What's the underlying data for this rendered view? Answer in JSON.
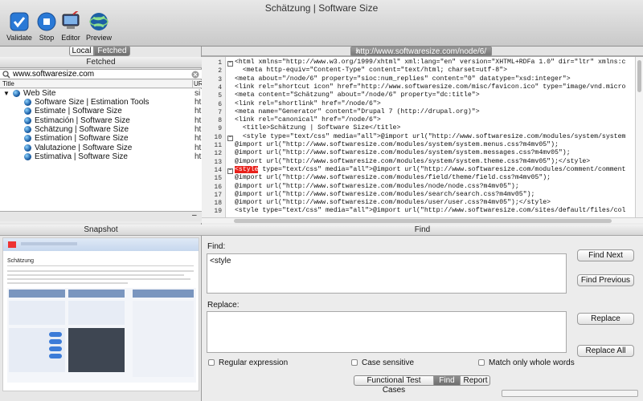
{
  "window": {
    "title": "Schätzung | Software Size"
  },
  "toolbar": [
    {
      "label": "Validate",
      "icon": "validate-icon"
    },
    {
      "label": "Stop",
      "icon": "stop-icon"
    },
    {
      "label": "Editor",
      "icon": "editor-icon"
    },
    {
      "label": "Preview",
      "icon": "preview-icon"
    }
  ],
  "left": {
    "segments": [
      "Local",
      "Fetched"
    ],
    "header": "Fetched",
    "url_input": "www.softwaresize.com",
    "clear_icon": "clear-search-icon",
    "columns": [
      "Title",
      "UR"
    ],
    "root": "Web Site",
    "root_url": "si",
    "items": [
      {
        "title": "Software Size | Estimation Tools",
        "url": "ht"
      },
      {
        "title": "Estimate | Software Size",
        "url": "ht"
      },
      {
        "title": "Estimación | Software Size",
        "url": "ht"
      },
      {
        "title": "Schätzung | Software Size",
        "url": "ht"
      },
      {
        "title": "Estimation | Software Size",
        "url": "ht"
      },
      {
        "title": "Valutazione | Software Size",
        "url": "ht"
      },
      {
        "title": "Estimativa | Software Size",
        "url": "ht"
      }
    ],
    "bottom_button": "–"
  },
  "editor": {
    "tab": "http://www.softwaresize.com/node/6/",
    "lines": [
      "<html xmlns=\"http://www.w3.org/1999/xhtml\" xml:lang=\"en\" version=\"XHTML+RDFa 1.0\" dir=\"ltr\" xmlns:c",
      "  <meta http-equiv=\"Content-Type\" content=\"text/html; charset=utf-8\">",
      "<meta about=\"/node/6\" property=\"sioc:num_replies\" content=\"0\" datatype=\"xsd:integer\">",
      "<link rel=\"shortcut icon\" href=\"http://www.softwaresize.com/misc/favicon.ico\" type=\"image/vnd.micro",
      "<meta content=\"Schätzung\" about=\"/node/6\" property=\"dc:title\">",
      "<link rel=\"shortlink\" href=\"/node/6\">",
      "<meta name=\"Generator\" content=\"Drupal 7 (http://drupal.org)\">",
      "<link rel=\"canonical\" href=\"/node/6\">",
      "  <title>Schätzung | Software Size</title>",
      "  <style type=\"text/css\" media=\"all\">@import url(\"http://www.softwaresize.com/modules/system/system",
      "@import url(\"http://www.softwaresize.com/modules/system/system.menus.css?m4mv05\");",
      "@import url(\"http://www.softwaresize.com/modules/system/system.messages.css?m4mv05\");",
      "@import url(\"http://www.softwaresize.com/modules/system/system.theme.css?m4mv05\");</style>",
      "<style type=\"text/css\" media=\"all\">@import url(\"http://www.softwaresize.com/modules/comment/comment",
      "@import url(\"http://www.softwaresize.com/modules/field/theme/field.css?m4mv05\");",
      "@import url(\"http://www.softwaresize.com/modules/node/node.css?m4mv05\");",
      "@import url(\"http://www.softwaresize.com/modules/search/search.css?m4mv05\");",
      "@import url(\"http://www.softwaresize.com/modules/user/user.css?m4mv05\");</style>",
      "<style type=\"text/css\" media=\"all\">@import url(\"http://www.softwaresize.com/sites/default/files/col"
    ],
    "line_numbers": [
      "1",
      "2",
      "3",
      "4",
      "5",
      "6",
      "7",
      "8",
      "9",
      "10",
      "11",
      "12",
      "13",
      "14",
      "15",
      "16",
      "17",
      "18",
      "19"
    ],
    "highlight": "<style"
  },
  "snapshot": {
    "header": "Snapshot",
    "page_heading": "Schätzung"
  },
  "find": {
    "header": "Find",
    "find_label": "Find:",
    "find_value": "<style",
    "replace_label": "Replace:",
    "replace_value": "",
    "buttons": [
      "Find Next",
      "Find Previous",
      "Replace",
      "Replace All"
    ],
    "options": [
      "Regular expression",
      "Case sensitive",
      "Match only whole words"
    ],
    "tabs": [
      "Functional Test Cases",
      "Find",
      "Report"
    ],
    "active_tab": "Find"
  },
  "colors": {
    "accent": "#1d5fa5",
    "highlight": "#e8201a",
    "tab_active": "#8a8a8a"
  }
}
